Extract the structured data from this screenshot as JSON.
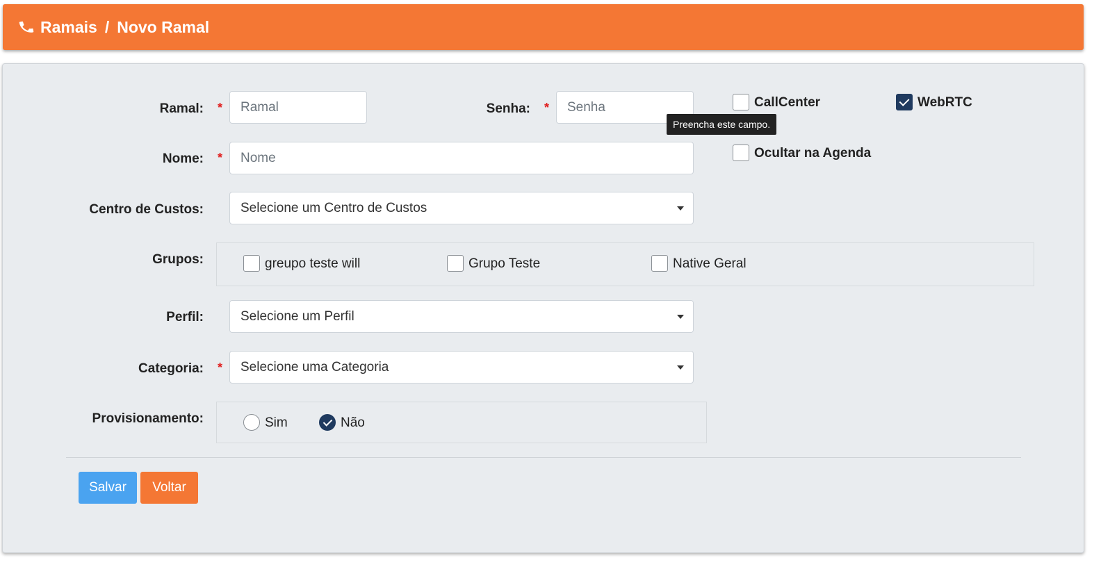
{
  "header": {
    "icon": "phone-icon",
    "crumb_1": "Ramais",
    "separator": "/",
    "crumb_2": "Novo Ramal",
    "color": "#f47734"
  },
  "form": {
    "ramal": {
      "label": "Ramal:",
      "required": "*",
      "placeholder": "Ramal",
      "value": ""
    },
    "senha": {
      "label": "Senha:",
      "required": "*",
      "placeholder": "Senha",
      "value": ""
    },
    "tooltip": "Preencha este campo.",
    "callcenter": {
      "label": "CallCenter",
      "checked": false
    },
    "webrtc": {
      "label": "WebRTC",
      "checked": true
    },
    "ocultar": {
      "label": "Ocultar na Agenda",
      "checked": false
    },
    "nome": {
      "label": "Nome:",
      "required": "*",
      "placeholder": "Nome",
      "value": ""
    },
    "centro": {
      "label": "Centro de Custos:",
      "selected": "Selecione um Centro de Custos"
    },
    "grupos": {
      "label": "Grupos:",
      "options": [
        {
          "label": "greupo teste will",
          "checked": false
        },
        {
          "label": "Grupo Teste",
          "checked": false
        },
        {
          "label": "Native Geral",
          "checked": false
        }
      ]
    },
    "perfil": {
      "label": "Perfil:",
      "selected": "Selecione um Perfil"
    },
    "categoria": {
      "label": "Categoria:",
      "required": "*",
      "selected": "Selecione uma Categoria"
    },
    "provisionamento": {
      "label": "Provisionamento:",
      "options": [
        {
          "label": "Sim",
          "checked": false
        },
        {
          "label": "Não",
          "checked": true
        }
      ]
    }
  },
  "buttons": {
    "save": {
      "label": "Salvar",
      "color": "#4aa3f0"
    },
    "back": {
      "label": "Voltar",
      "color": "#f47734"
    }
  }
}
